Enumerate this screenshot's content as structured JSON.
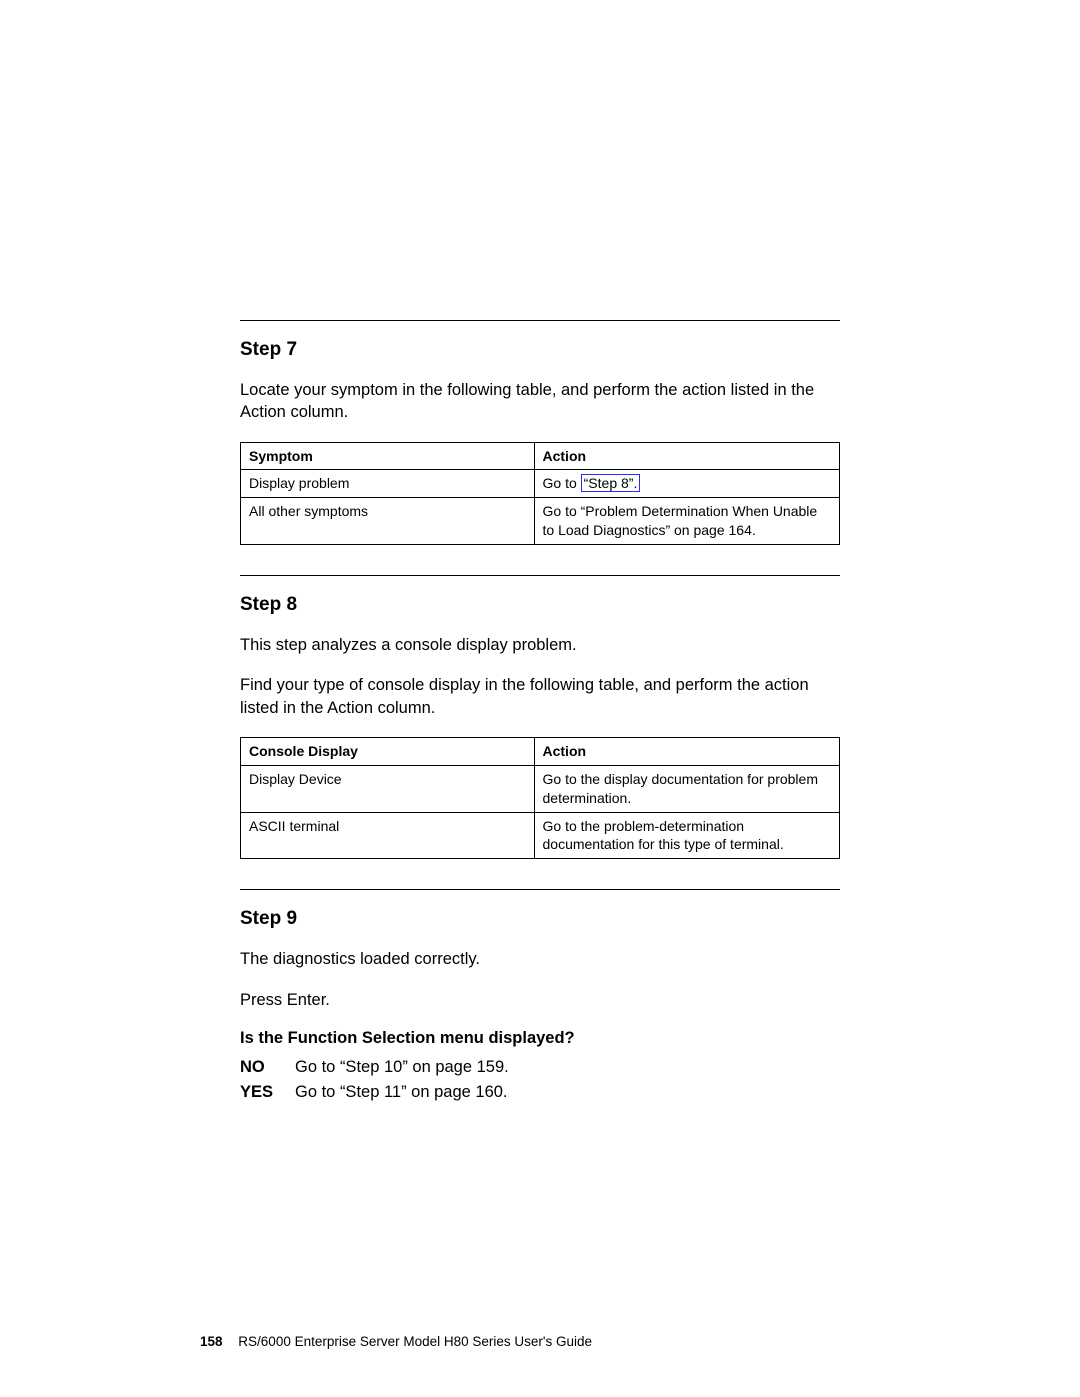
{
  "step7": {
    "heading": "Step 7",
    "intro": "Locate your symptom in the following table, and perform the action listed in the Action column.",
    "headers": {
      "c1": "Symptom",
      "c2": "Action"
    },
    "rows": [
      {
        "c1": "Display problem",
        "c2_prefix": "Go to ",
        "c2_link": "“Step 8”.",
        "c2_suffix": ""
      },
      {
        "c1": "All other symptoms",
        "c2": "Go to “Problem Determination When Unable to Load Diagnostics” on page 164."
      }
    ]
  },
  "step8": {
    "heading": "Step 8",
    "p1": "This step analyzes a console display problem.",
    "p2": "Find your type of console display in the following table, and perform the action listed in the Action column.",
    "headers": {
      "c1": "Console Display",
      "c2": "Action"
    },
    "rows": [
      {
        "c1": "Display Device",
        "c2": "Go to the display documentation for problem determination."
      },
      {
        "c1": "ASCII terminal",
        "c2": "Go to the problem-determination documentation for this type of terminal."
      }
    ]
  },
  "step9": {
    "heading": "Step 9",
    "p1": "The diagnostics loaded correctly.",
    "p2": "Press Enter.",
    "question": "Is the Function Selection menu displayed?",
    "answers": [
      {
        "label": "NO",
        "text": "Go to “Step 10” on page 159."
      },
      {
        "label": "YES",
        "text": "Go to “Step 11” on page 160."
      }
    ]
  },
  "footer": {
    "page_number": "158",
    "title": "RS/6000 Enterprise Server Model H80 Series User's Guide"
  }
}
